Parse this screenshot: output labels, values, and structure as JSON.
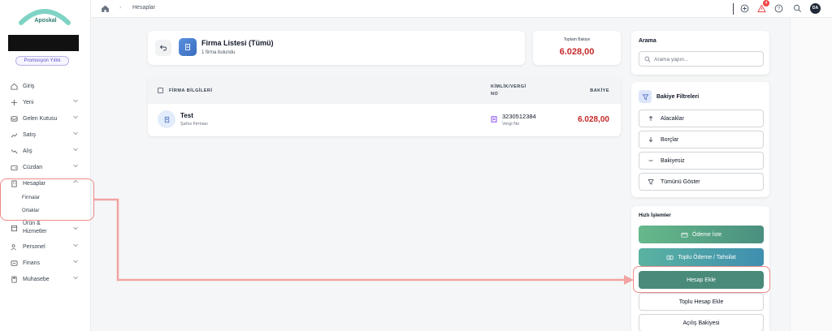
{
  "brand": {
    "name": "Aposkal",
    "plan": "Promosyon Yıllık"
  },
  "sidebar": {
    "items": [
      {
        "label": "Giriş",
        "icon": "home-icon"
      },
      {
        "label": "Yeni",
        "icon": "plus-icon"
      },
      {
        "label": "Gelen Kutusu",
        "icon": "inbox-icon"
      },
      {
        "label": "Satış",
        "icon": "trend-up-icon"
      },
      {
        "label": "Alış",
        "icon": "trend-down-icon"
      },
      {
        "label": "Cüzdan",
        "icon": "wallet-icon"
      },
      {
        "label": "Hesaplar",
        "icon": "building-icon"
      },
      {
        "label": "Ürün & Hizmetler",
        "icon": "box-icon"
      },
      {
        "label": "Personel",
        "icon": "users-icon"
      },
      {
        "label": "Finans",
        "icon": "finance-icon"
      },
      {
        "label": "Muhasebe",
        "icon": "calculator-icon"
      }
    ],
    "sub_items": [
      "Firmalar",
      "Ortaklar"
    ]
  },
  "topbar": {
    "breadcrumb": "Hesaplar",
    "notification_count": "4",
    "avatar_initials": "DA"
  },
  "header": {
    "title": "Firma Listesi (Tümü)",
    "subtitle": "1 firma bulundu"
  },
  "balance": {
    "label": "Toplam Bakiye",
    "value": "6.028,00"
  },
  "table": {
    "headers": {
      "firm": "FİRMA BİLGİLERİ",
      "id_line1": "KİMLİK/VERGİ",
      "id_line2": "NO",
      "balance": "BAKİYE"
    },
    "rows": [
      {
        "name": "Test",
        "type": "Şahıs Firması",
        "tax_no": "3230512384",
        "tax_label": "Vergi No",
        "balance": "6.028,00"
      }
    ]
  },
  "search": {
    "title": "Arama",
    "placeholder": "Arama yapın..."
  },
  "filters": {
    "title": "Bakiye Filtreleri",
    "items": [
      "Alacaklar",
      "Borçlar",
      "Bakiyesiz",
      "Tümünü Göster"
    ]
  },
  "quick": {
    "title": "Hızlı İşlemler",
    "request_payment": "Ödeme İste",
    "bulk_payment": "Toplu Ödeme / Tahsilat",
    "add_account": "Hesap Ekle",
    "bulk_add": "Toplu Hesap Ekle",
    "opening_balance": "Açılış Bakiyesi"
  },
  "colors": {
    "negative": "#c62828",
    "accent": "#4a8a7a",
    "highlight": "#ef8a8a"
  }
}
